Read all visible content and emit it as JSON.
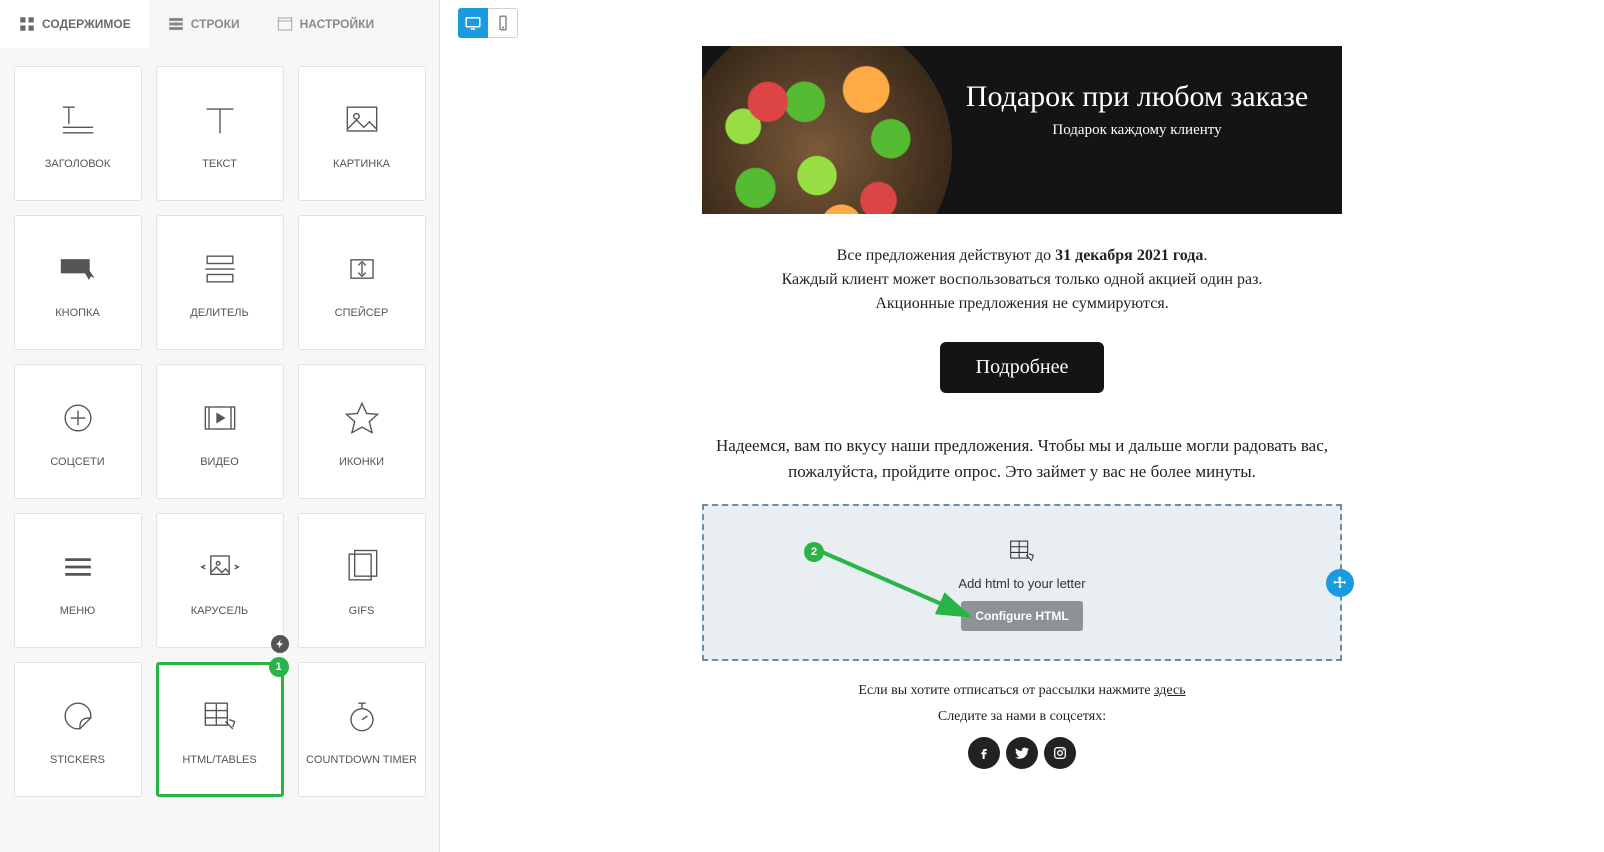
{
  "tabs": {
    "content": "СОДЕРЖИМОЕ",
    "rows": "СТРОКИ",
    "settings": "НАСТРОЙКИ"
  },
  "tiles": {
    "heading": "ЗАГОЛОВОК",
    "text": "ТЕКСТ",
    "image": "КАРТИНКА",
    "button": "КНОПКА",
    "divider": "ДЕЛИТЕЛЬ",
    "spacer": "СПЕЙСЕР",
    "social": "СОЦСЕТИ",
    "video": "ВИДЕО",
    "icons": "ИКОНКИ",
    "menu": "МЕНЮ",
    "carousel": "КАРУСЕЛЬ",
    "gifs": "GIFS",
    "stickers": "STICKERS",
    "html": "HTML/TABLES",
    "countdown": "COUNTDOWN TIMER"
  },
  "marker": {
    "one": "1",
    "two": "2"
  },
  "hero": {
    "title": "Подарок при любом заказе",
    "subtitle": "Подарок каждому клиенту"
  },
  "promo": {
    "line_prefix": "Все предложения действуют до ",
    "date_bold": "31 декабря 2021 года",
    "line_suffix": ".",
    "line2": "Каждый клиент может воспользоваться только одной акцией один раз.",
    "line3": "Акционные предложения не суммируются.",
    "cta": "Подробнее"
  },
  "survey": "Надеемся, вам по вкусу наши предложения. Чтобы мы и дальше могли радовать вас, пожалуйста, пройдите опрос. Это займет у вас не более минуты.",
  "dropzone": {
    "add_text": "Add html to your letter",
    "button": "Configure HTML"
  },
  "footer": {
    "unsub_prefix": "Если вы хотите отписаться от рассылки нажмите ",
    "unsub_link": "здесь",
    "follow": "Следите за нами в соцсетях:"
  }
}
